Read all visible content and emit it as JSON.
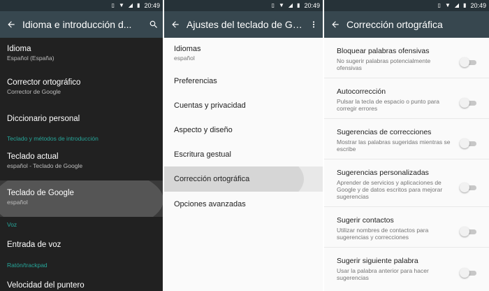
{
  "status": {
    "time": "20:49"
  },
  "screen1": {
    "title": "Idioma e introducción d...",
    "items": [
      {
        "title": "Idioma",
        "subtitle": "Español (España)"
      },
      {
        "title": "Corrector ortográfico",
        "subtitle": "Corrector de Google"
      },
      {
        "title": "Diccionario personal",
        "subtitle": ""
      }
    ],
    "section_keyboard": "Teclado y métodos de introducción",
    "keyboard_items": [
      {
        "title": "Teclado actual",
        "subtitle": "español - Teclado de Google"
      },
      {
        "title": "Teclado de Google",
        "subtitle": "español"
      }
    ],
    "section_voice": "Voz",
    "voice_item": "Entrada de voz",
    "section_trackpad": "Ratón/trackpad",
    "trackpad_item": "Velocidad del puntero"
  },
  "screen2": {
    "title": "Ajustes del teclado de Goo...",
    "items": [
      {
        "title": "Idiomas",
        "subtitle": "español"
      },
      {
        "title": "Preferencias"
      },
      {
        "title": "Cuentas y privacidad"
      },
      {
        "title": "Aspecto y diseño"
      },
      {
        "title": "Escritura gestual"
      },
      {
        "title": "Corrección ortográfica"
      },
      {
        "title": "Opciones avanzadas"
      }
    ]
  },
  "screen3": {
    "title": "Corrección ortográfica",
    "items": [
      {
        "title": "Bloquear palabras ofensivas",
        "subtitle": "No sugerir palabras potencialmente ofensivas",
        "enabled": false
      },
      {
        "title": "Autocorrección",
        "subtitle": "Pulsar la tecla de espacio o punto para corregir errores",
        "enabled": false
      },
      {
        "title": "Sugerencias de correcciones",
        "subtitle": "Mostrar las palabras sugeridas mientras se escribe",
        "enabled": false
      },
      {
        "title": "Sugerencias personalizadas",
        "subtitle": "Aprender de servicios y aplicaciones de Google y de datos escritos para mejorar sugerencias",
        "enabled": false
      },
      {
        "title": "Sugerir contactos",
        "subtitle": "Utilizar nombres de contactos para sugerencias y correcciones",
        "enabled": false
      },
      {
        "title": "Sugerir siguiente palabra",
        "subtitle": "Usar la palabra anterior para hacer sugerencias",
        "enabled": false
      }
    ]
  },
  "colors": {
    "statusbar": "#263238",
    "appbar": "#37474f",
    "accent": "#26a69a",
    "dark_bg": "#212121"
  },
  "icons": {
    "back": "arrow-back-icon",
    "search": "search-icon",
    "overflow": "more-vert-icon"
  }
}
